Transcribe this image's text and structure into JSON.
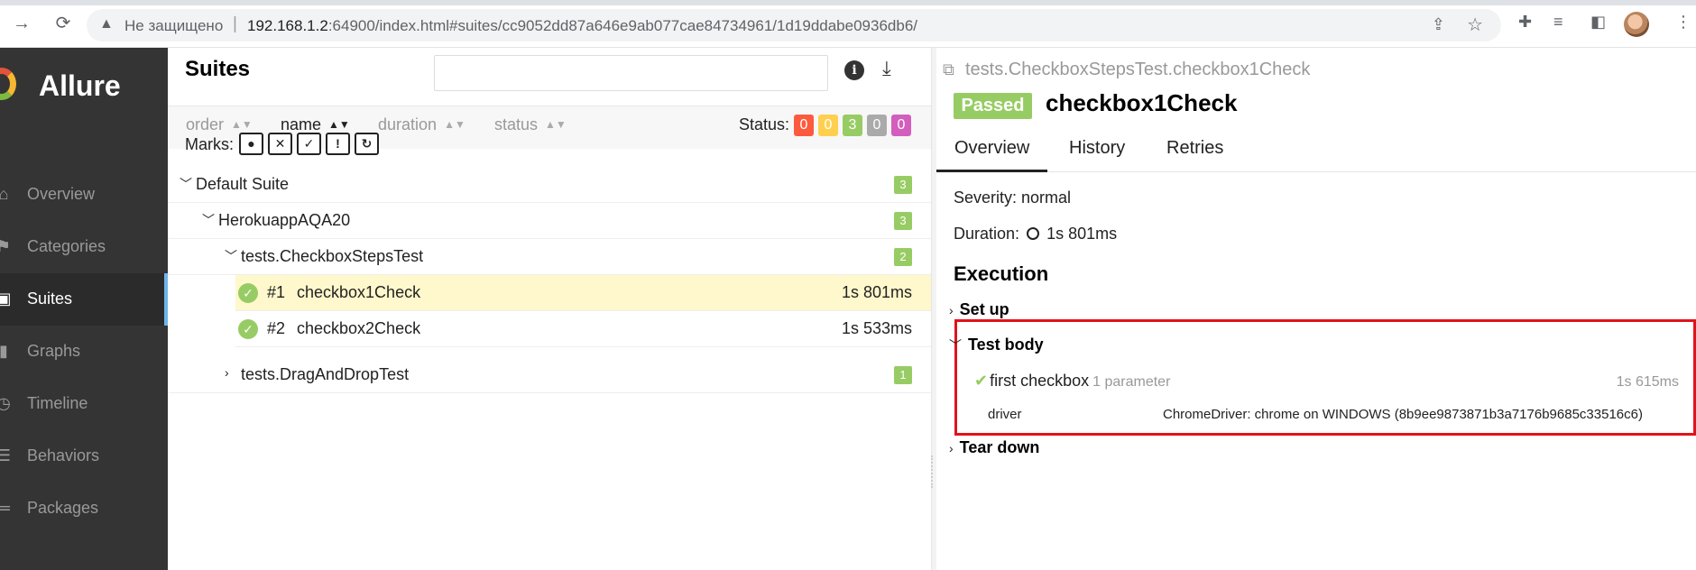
{
  "browser": {
    "insecure_label": "Не защищено",
    "separator": "|",
    "url_host": "192.168.1.2",
    "url_rest": ":64900/index.html#suites/cc9052dd87a646e9ab077cae84734961/1d19ddabe0936db6/"
  },
  "sidebar": {
    "logo": "Allure",
    "items": [
      {
        "label": "Overview",
        "icon": "home-icon"
      },
      {
        "label": "Categories",
        "icon": "flag-icon"
      },
      {
        "label": "Suites",
        "icon": "briefcase-icon"
      },
      {
        "label": "Graphs",
        "icon": "bar-chart-icon"
      },
      {
        "label": "Timeline",
        "icon": "clock-icon"
      },
      {
        "label": "Behaviors",
        "icon": "list-icon"
      },
      {
        "label": "Packages",
        "icon": "tree-icon"
      }
    ]
  },
  "suites": {
    "title": "Suites",
    "search_value": "",
    "sort": {
      "order": "order",
      "name": "name",
      "duration": "duration",
      "status": "status"
    },
    "status_label": "Status:",
    "status_counts": [
      {
        "value": "0",
        "color": "#fd5a3e"
      },
      {
        "value": "0",
        "color": "#ffd050"
      },
      {
        "value": "3",
        "color": "#97cc64"
      },
      {
        "value": "0",
        "color": "#aaaaaa"
      },
      {
        "value": "0",
        "color": "#d35ebe"
      }
    ],
    "marks_label": "Marks:",
    "tree": {
      "default_suite": {
        "name": "Default Suite",
        "count": "3"
      },
      "project": {
        "name": "HerokuappAQA20",
        "count": "3"
      },
      "class1": {
        "name": "tests.CheckboxStepsTest",
        "count": "2"
      },
      "test1": {
        "num": "#1",
        "name": "checkbox1Check",
        "duration": "1s 801ms"
      },
      "test2": {
        "num": "#2",
        "name": "checkbox2Check",
        "duration": "1s 533ms"
      },
      "class2": {
        "name": "tests.DragAndDropTest",
        "count": "1"
      }
    }
  },
  "result": {
    "full_name": "tests.CheckboxStepsTest.checkbox1Check",
    "status": "Passed",
    "title": "checkbox1Check",
    "tabs": [
      "Overview",
      "History",
      "Retries"
    ],
    "severity": "Severity: normal",
    "duration_label": "Duration:",
    "duration_value": "1s 801ms",
    "execution": "Execution",
    "setup": "Set up",
    "test_body": "Test body",
    "step_name": "first checkbox",
    "step_params": "1 parameter",
    "step_duration": "1s 615ms",
    "param_name": "driver",
    "param_value": "ChromeDriver: chrome on WINDOWS (8b9ee9873871b3a7176b9685c33516c6)",
    "teardown": "Tear down"
  }
}
